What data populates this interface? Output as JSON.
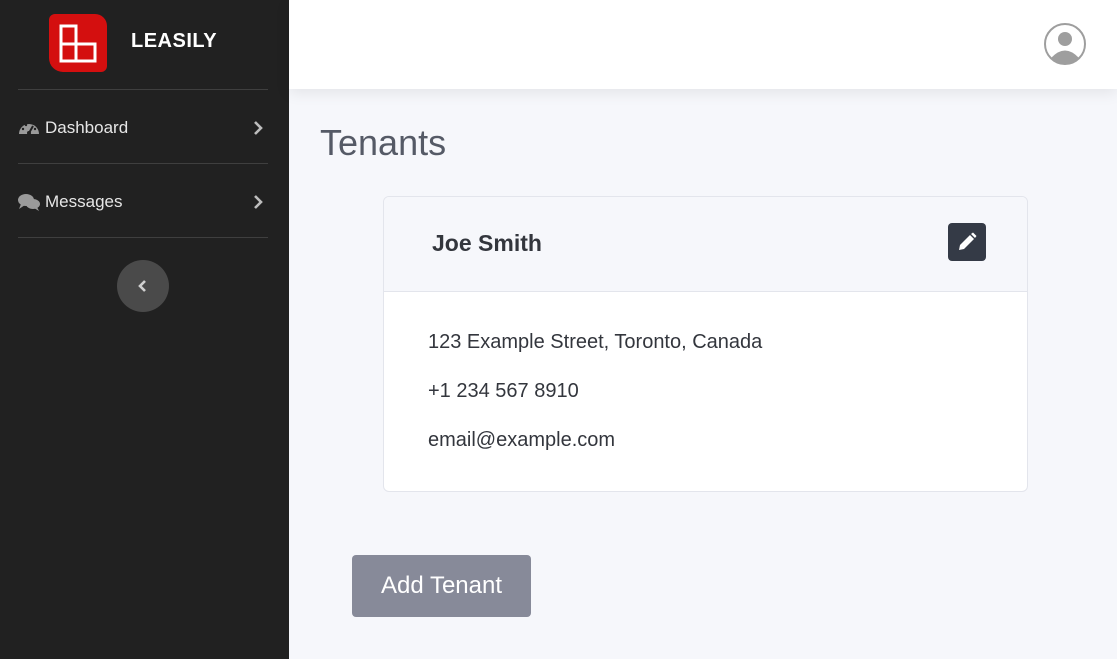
{
  "app": {
    "brand": "LEASILY",
    "brand_color": "#d40f0f"
  },
  "sidebar": {
    "items": [
      {
        "label": "Dashboard",
        "icon": "dashboard-icon"
      },
      {
        "label": "Messages",
        "icon": "messages-icon"
      }
    ],
    "collapse_icon": "chevron-left-icon"
  },
  "topbar": {
    "avatar_icon": "user-avatar-icon"
  },
  "main": {
    "title": "Tenants",
    "tenant": {
      "name": "Joe Smith",
      "address": "123 Example Street, Toronto, Canada",
      "phone": "+1 234 567 8910",
      "email": "email@example.com",
      "edit_icon": "pencil-icon"
    },
    "add_button": "Add Tenant"
  },
  "colors": {
    "sidebar_bg": "#212121",
    "page_bg": "#f6f7fb",
    "edit_button": "#343a46",
    "add_button": "#878a99"
  }
}
